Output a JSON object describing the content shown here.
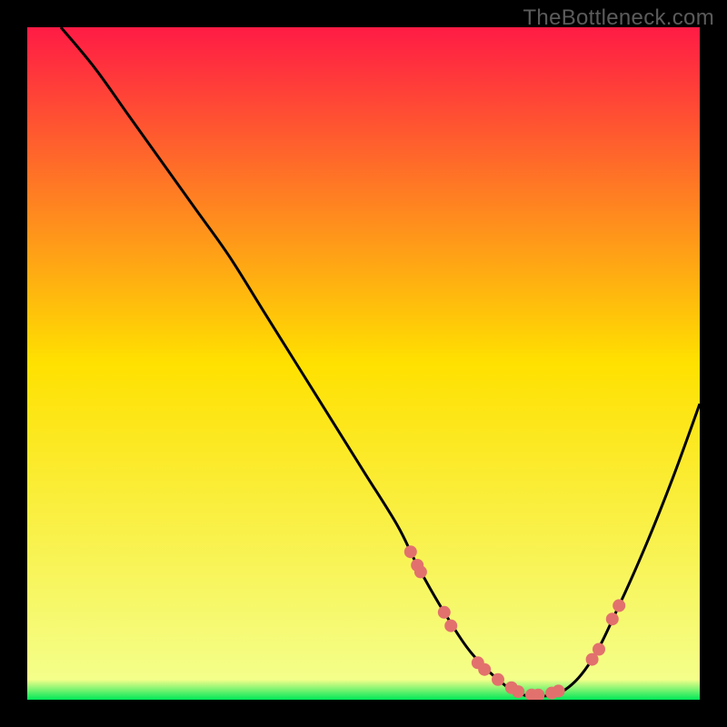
{
  "watermark": "TheBottleneck.com",
  "chart_data": {
    "type": "line",
    "title": "",
    "xlabel": "",
    "ylabel": "",
    "xlim": [
      0,
      100
    ],
    "ylim": [
      0,
      100
    ],
    "grid": false,
    "legend": false,
    "gradient_background": {
      "top_color": "#ff1b45",
      "mid_color": "#ffe100",
      "bottom_color": "#00e858"
    },
    "series": [
      {
        "name": "curve",
        "x": [
          5,
          10,
          15,
          20,
          25,
          30,
          35,
          40,
          45,
          50,
          55,
          58,
          62,
          66,
          70,
          73,
          76,
          80,
          84,
          88,
          92,
          96,
          100
        ],
        "y": [
          100,
          94,
          87,
          80,
          73,
          66,
          58,
          50,
          42,
          34,
          26,
          20,
          13,
          7,
          3,
          1,
          0.5,
          1.5,
          6,
          14,
          23,
          33,
          44
        ]
      }
    ],
    "markers": {
      "name": "points",
      "x": [
        57,
        58,
        58.5,
        62,
        63,
        67,
        68,
        70,
        72,
        73,
        75,
        76,
        78,
        79,
        84,
        85,
        87,
        88
      ],
      "y": [
        22,
        20,
        19,
        13,
        11,
        5.5,
        4.5,
        3,
        1.8,
        1.2,
        0.7,
        0.7,
        1,
        1.3,
        6,
        7.5,
        12,
        14
      ],
      "color": "#e2716d",
      "radius": 7
    }
  }
}
